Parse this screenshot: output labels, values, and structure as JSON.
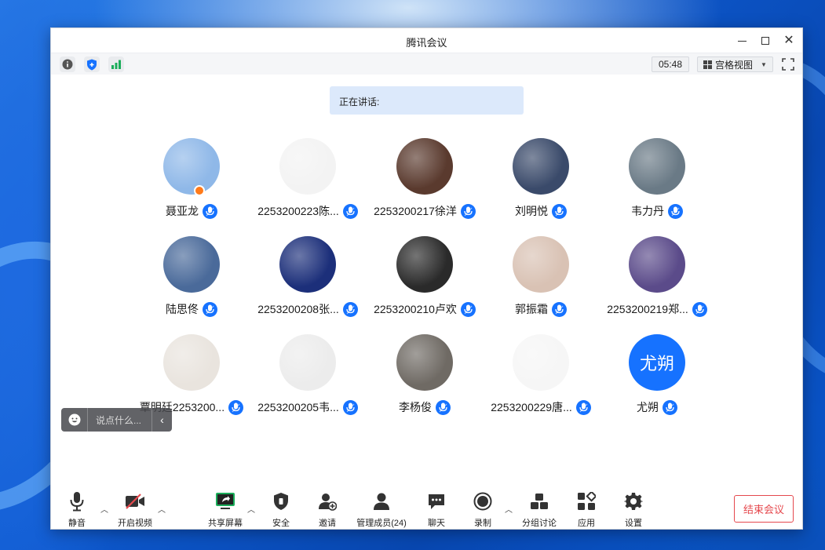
{
  "window": {
    "title": "腾讯会议"
  },
  "infobar": {
    "timer": "05:48",
    "view_mode": "宫格视图"
  },
  "speaking_label": "正在讲话:",
  "participants": [
    {
      "name": "聂亚龙",
      "avatar_color": "#8fb8e8",
      "host": true
    },
    {
      "name": "2253200223陈...",
      "avatar_color": "#f3f3f3",
      "host": false
    },
    {
      "name": "2253200217徐洋",
      "avatar_color": "#5a3a2e",
      "host": false
    },
    {
      "name": "刘明悦",
      "avatar_color": "#3a4a6a",
      "host": false
    },
    {
      "name": "韦力丹",
      "avatar_color": "#6a7a86",
      "host": false
    },
    {
      "name": "陆思佟",
      "avatar_color": "#4a6a9a",
      "host": false
    },
    {
      "name": "2253200208张...",
      "avatar_color": "#1c2f7a",
      "host": false
    },
    {
      "name": "2253200210卢欢",
      "avatar_color": "#2a2a2a",
      "host": false
    },
    {
      "name": "郭振霜",
      "avatar_color": "#d9c2b4",
      "host": false
    },
    {
      "name": "2253200219郑...",
      "avatar_color": "#5b4b8a",
      "host": false
    },
    {
      "name": "覃明廷2253200...",
      "avatar_color": "#e9e4de",
      "host": false
    },
    {
      "name": "2253200205韦...",
      "avatar_color": "#ececec",
      "host": false
    },
    {
      "name": "李杨俊",
      "avatar_color": "#6f6a64",
      "host": false
    },
    {
      "name": "2253200229唐...",
      "avatar_color": "#f6f6f6",
      "host": false
    },
    {
      "name": "尤朔",
      "avatar_color": "#1672ff",
      "host": false,
      "avatar_text": "尤朔"
    }
  ],
  "chat": {
    "placeholder": "说点什么..."
  },
  "toolbar": {
    "mute": "静音",
    "video": "开启视频",
    "share": "共享屏幕",
    "security": "安全",
    "invite": "邀请",
    "members": "管理成员(24)",
    "chat": "聊天",
    "record": "录制",
    "breakout": "分组讨论",
    "apps": "应用",
    "settings": "设置",
    "end": "结束会议"
  },
  "colors": {
    "accent": "#1672ff",
    "danger": "#e5484d",
    "share_green": "#1aad5a"
  }
}
